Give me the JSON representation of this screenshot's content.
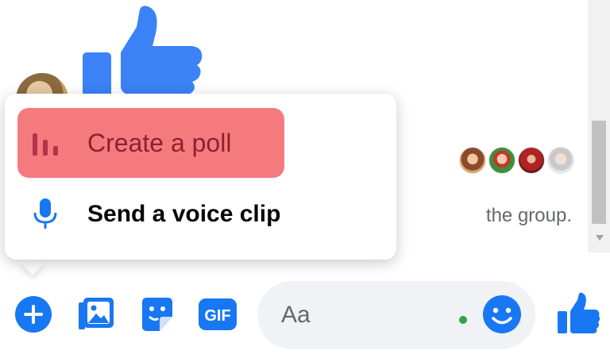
{
  "colors": {
    "messenger_blue": "#1877f2",
    "poll_highlight": "#f57a7e",
    "poll_text": "#8e2130",
    "active_green": "#31a24c"
  },
  "thread": {
    "big_message": "thumbs-up-icon",
    "system_text": "the group."
  },
  "popup_menu": {
    "items": [
      {
        "label": "Create a poll",
        "icon": "poll-icon",
        "highlighted": true
      },
      {
        "label": "Send a voice clip",
        "icon": "microphone-icon",
        "highlighted": false
      }
    ]
  },
  "composer": {
    "actions": [
      "add-icon",
      "photo-icon",
      "sticker-icon",
      "gif-icon"
    ],
    "gif_label": "GIF",
    "placeholder": "Aa",
    "emoji_icon": "smiley-icon",
    "send_icon": "thumbs-up-icon"
  }
}
